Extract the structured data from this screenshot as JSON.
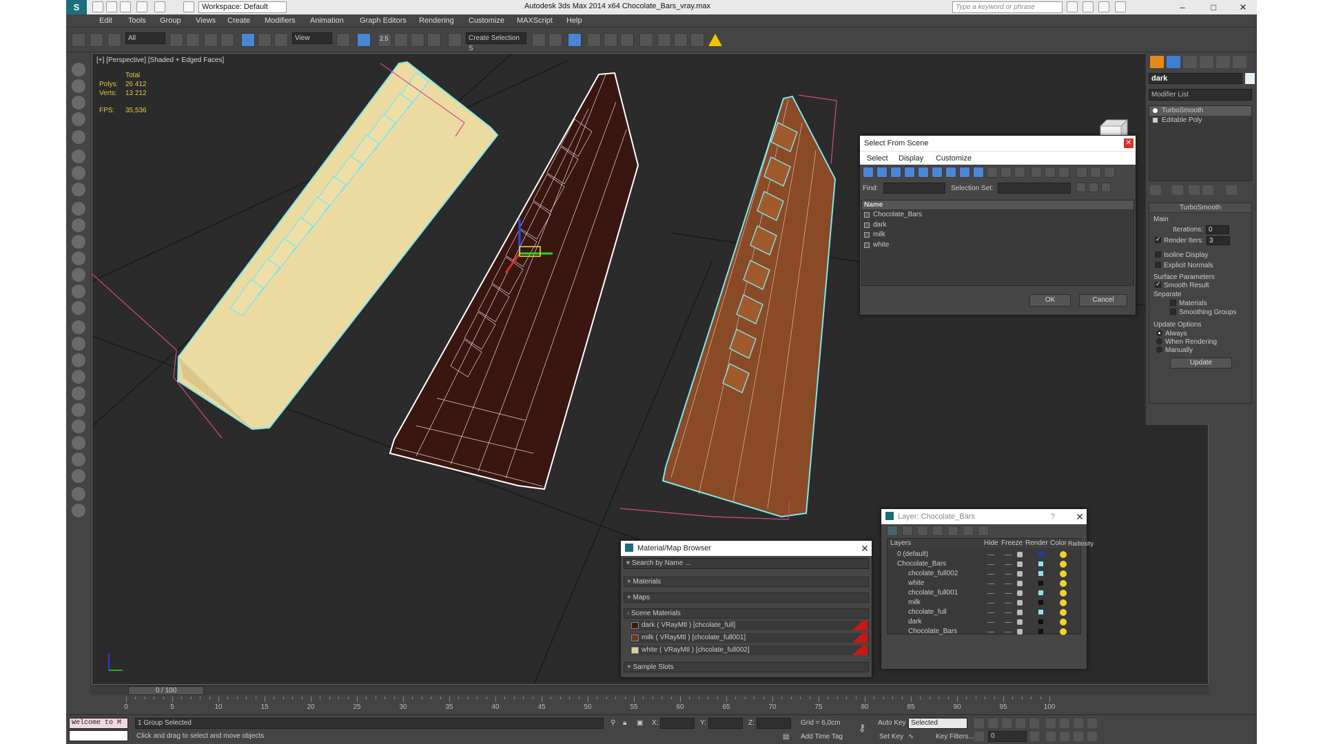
{
  "app": {
    "title": "Autodesk 3ds Max  2014 x64     Chocolate_Bars_vray.max",
    "workspace": "Workspace: Default",
    "search_placeholder": "Type a keyword or phrase",
    "menu": [
      "Edit",
      "Tools",
      "Group",
      "Views",
      "Create",
      "Modifiers",
      "Animation",
      "Graph Editors",
      "Rendering",
      "Customize",
      "MAXScript",
      "Help"
    ]
  },
  "toolbar": {
    "filter_select": "All",
    "refcoord_select": "View",
    "selection_set": "Create Selection S",
    "snap_label": "2.5"
  },
  "viewport": {
    "label": "[+] [Perspective] [Shaded + Edged Faces]",
    "stats": {
      "total": "Total",
      "polys_label": "Polys:",
      "polys": "26 412",
      "verts_label": "Verts:",
      "verts": "13 212",
      "fps_label": "FPS:",
      "fps": "35,536"
    }
  },
  "command_panel": {
    "object_name": "dark",
    "modifier_list": "Modifier List",
    "stack": [
      "TurboSmooth",
      "Editable Poly"
    ],
    "rollout_title": "TurboSmooth",
    "main_label": "Main",
    "iterations_label": "Iterations:",
    "iterations": "0",
    "render_iters_label": "Render Iters:",
    "render_iters": "3",
    "isoline": "Isoline Display",
    "explicit_normals": "Explicit Normals",
    "surface_params": "Surface Parameters",
    "smooth_result": "Smooth Result",
    "separate": "Separate",
    "materials": "Materials",
    "smoothing_groups": "Smoothing Groups",
    "update_options": "Update Options",
    "always": "Always",
    "when_rendering": "When Rendering",
    "manually": "Manually",
    "update_button": "Update"
  },
  "select_dialog": {
    "title": "Select From Scene",
    "menu": [
      "Select",
      "Display",
      "Customize"
    ],
    "find_label": "Find:",
    "selset_label": "Selection Set:",
    "column": "Name",
    "items": [
      "Chocolate_Bars",
      "dark",
      "milk",
      "white"
    ],
    "ok": "OK",
    "cancel": "Cancel"
  },
  "material_browser": {
    "title": "Material/Map Browser",
    "search": "Search by Name ...",
    "sections": [
      "+ Materials",
      "+ Maps",
      "- Scene Materials",
      "+ Sample Slots"
    ],
    "materials": [
      "dark  ( VRayMtl )  [chcolate_full]",
      "milk  ( VRayMtl )  [chcolate_full001]",
      "white  ( VRayMtl )  [chcolate_full002]"
    ],
    "swatch_colors": [
      "#3a1c14",
      "#6a3a20",
      "#d9cda0"
    ]
  },
  "layer_dialog": {
    "title": "Layer: Chocolate_Bars",
    "help": "?",
    "columns": [
      "Layers",
      "Hide",
      "Freeze",
      "Render",
      "Color",
      "Radiosity"
    ],
    "rows": [
      {
        "name": "0 (default)",
        "color": "#1a3fa8"
      },
      {
        "name": "Chocolate_Bars",
        "color": "#8fe3f0"
      },
      {
        "name": "chcolate_full002",
        "color": "#8fe3f0"
      },
      {
        "name": "white",
        "color": "#111111"
      },
      {
        "name": "chcolate_full001",
        "color": "#8fe3f0"
      },
      {
        "name": "milk",
        "color": "#111111"
      },
      {
        "name": "chcolate_full",
        "color": "#8fe3f0"
      },
      {
        "name": "dark",
        "color": "#111111"
      },
      {
        "name": "Chocolate_Bars",
        "color": "#111111"
      }
    ]
  },
  "timeline": {
    "frame": "0 / 100",
    "ticks": [
      "0",
      "5",
      "10",
      "15",
      "20",
      "25",
      "30",
      "35",
      "40",
      "45",
      "50",
      "55",
      "60",
      "65",
      "70",
      "75",
      "80",
      "85",
      "90",
      "95",
      "100"
    ]
  },
  "status": {
    "maxscript": "Welcome to M",
    "selected": "1 Group Selected",
    "prompt": "Click and drag to select and move objects",
    "x_label": "X:",
    "y_label": "Y:",
    "z_label": "Z:",
    "grid": "Grid = 6,0cm",
    "add_time_tag": "Add Time Tag",
    "auto_key": "Auto Key",
    "set_key": "Set Key",
    "selected_combo": "Selected",
    "key_filters": "Key Filters...",
    "frame_field": "0"
  }
}
